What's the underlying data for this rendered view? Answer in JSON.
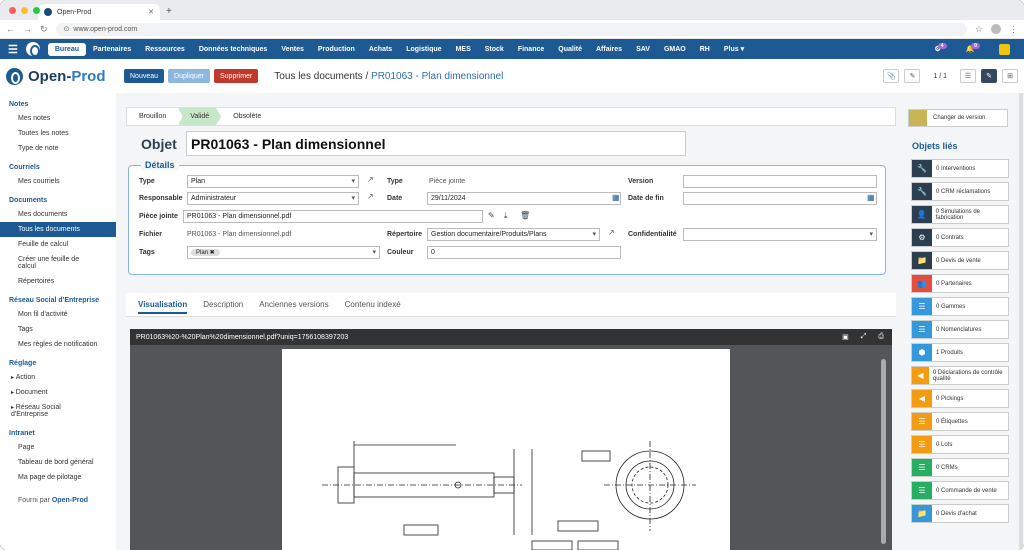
{
  "browser": {
    "tab_title": "Open-Prod",
    "url": "www.open-prod.com"
  },
  "topnav": {
    "items": [
      "Bureau",
      "Partenaires",
      "Ressources",
      "Données techniques",
      "Ventes",
      "Production",
      "Achats",
      "Logistique",
      "MES",
      "Stock",
      "Finance",
      "Qualité",
      "Affaires",
      "SAV",
      "GMAO",
      "RH",
      "Plus ▾"
    ],
    "badge1": "4",
    "badge2": "0"
  },
  "brand": {
    "name_a": "Open-",
    "name_b": "Prod"
  },
  "toolbar": {
    "new": "Nouveau",
    "duplicate": "Dupliquer",
    "delete": "Supprimer",
    "crumb_root": "Tous les documents",
    "crumb_sep": "/",
    "crumb_current": "PR01063 - Plan dimensionnel",
    "pager": "1 / 1"
  },
  "sidebar": {
    "notes": "Notes",
    "notes_items": [
      "Mes notes",
      "Toutes les notes",
      "Type de note"
    ],
    "mail": "Courriels",
    "mail_items": [
      "Mes courriels"
    ],
    "docs": "Documents",
    "docs_items": [
      "Mes documents",
      "Tous les documents",
      "Feuille de calcul",
      "Créer une feuille de calcul",
      "Répertoires"
    ],
    "rse": "Réseau Social d'Entreprise",
    "rse_items": [
      "Mon fil d'activité",
      "Tags",
      "Mes règles de notification"
    ],
    "reg": "Réglage",
    "reg_items": [
      "Action",
      "Document",
      "Réseau Social d'Entreprise"
    ],
    "intra": "Intranet",
    "intra_items": [
      "Page",
      "Tableau de bord général",
      "Ma page de pilotage"
    ],
    "footer_a": "Fourni par",
    "footer_b": "Open-Prod"
  },
  "status": {
    "steps": [
      "Brouillon",
      "Validé",
      "Obsolète"
    ]
  },
  "object": {
    "label": "Objet",
    "title": "PR01063 - Plan dimensionnel"
  },
  "details": {
    "legend": "Détails",
    "type_l": "Type",
    "type_v": "Plan",
    "resp_l": "Responsable",
    "resp_v": "Administrateur",
    "pj_l": "Pièce jointe",
    "pj_v": "PR01063 - Plan dimensionnel.pdf",
    "file_l": "Fichier",
    "file_v": "PR01063 - Plan dimensionnel.pdf",
    "tags_l": "Tags",
    "tag1": "Plan ✖",
    "type2_l": "Type",
    "type2_v": "Pièce jointe",
    "date_l": "Date",
    "date_v": "29/11/2024",
    "rep_l": "Répertoire",
    "rep_v": "Gestion documentaire/Produits/Plans",
    "color_l": "Couleur",
    "color_v": "0",
    "ver_l": "Version",
    "end_l": "Date de fin",
    "conf_l": "Confidentialité"
  },
  "tabs": [
    "Visualisation",
    "Description",
    "Anciennes versions",
    "Contenu indexé"
  ],
  "viewer": {
    "filename": "PR01063%20-%20Plan%20dimensionnel.pdf?uniq=1756108397203"
  },
  "rpanel": {
    "change_version": "Changer de version",
    "title": "Objets liés",
    "links": [
      {
        "label": "0 Interventions",
        "color": "#2c3e50",
        "icon": "wrench-icon"
      },
      {
        "label": "0 CRM réclamations",
        "color": "#2c3e50",
        "icon": "wrench-icon"
      },
      {
        "label": "0 Simulations de fabrication",
        "color": "#2c3e50",
        "icon": "user-icon"
      },
      {
        "label": "0 Contrats",
        "color": "#2c3e50",
        "icon": "gears-icon"
      },
      {
        "label": "0 Devis de vente",
        "color": "#2c3e50",
        "icon": "folder-icon"
      },
      {
        "label": "0 Partenaires",
        "color": "#e74c3c",
        "icon": "users-icon"
      },
      {
        "label": "0 Gammes",
        "color": "#3498db",
        "icon": "list-icon"
      },
      {
        "label": "0 Nomenclatures",
        "color": "#3498db",
        "icon": "list-icon"
      },
      {
        "label": "1 Produits",
        "color": "#3498db",
        "icon": "cubes-icon"
      },
      {
        "label": "0 Déclarations de contrôle qualité",
        "color": "#f39c12",
        "icon": "signal-icon"
      },
      {
        "label": "0 Pickings",
        "color": "#f39c12",
        "icon": "signal-icon"
      },
      {
        "label": "0 Étiquettes",
        "color": "#f39c12",
        "icon": "list-icon"
      },
      {
        "label": "0 Lots",
        "color": "#f39c12",
        "icon": "list-icon"
      },
      {
        "label": "0 CRMs",
        "color": "#27ae60",
        "icon": "list-icon"
      },
      {
        "label": "0 Commande de vente",
        "color": "#27ae60",
        "icon": "list-icon"
      },
      {
        "label": "0 Devis d'achat",
        "color": "#3498db",
        "icon": "folder-icon"
      }
    ]
  }
}
